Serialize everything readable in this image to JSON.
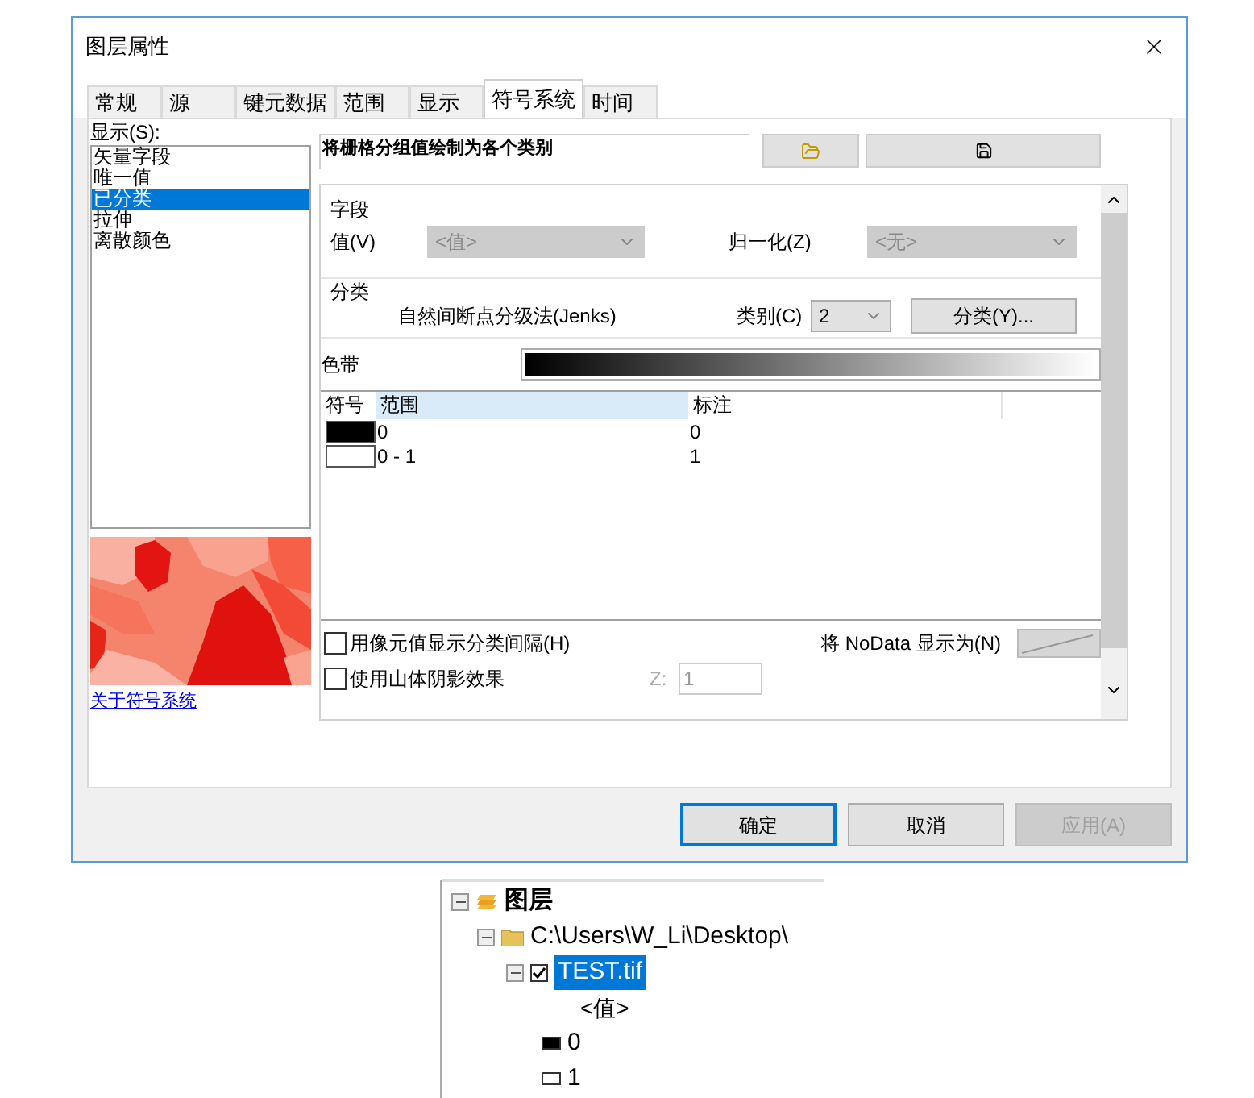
{
  "window": {
    "title": "图层属性"
  },
  "tabs": [
    {
      "label": "常规",
      "selected": false
    },
    {
      "label": "源",
      "selected": false
    },
    {
      "label": "键元数据",
      "selected": false
    },
    {
      "label": "范围",
      "selected": false
    },
    {
      "label": "显示",
      "selected": false
    },
    {
      "label": "符号系统",
      "selected": true
    },
    {
      "label": "时间",
      "selected": false
    }
  ],
  "show_list": {
    "label": "显示(S):",
    "items": [
      {
        "label": "矢量字段",
        "selected": false
      },
      {
        "label": "唯一值",
        "selected": false
      },
      {
        "label": "已分类",
        "selected": true
      },
      {
        "label": "拉伸",
        "selected": false
      },
      {
        "label": "离散颜色",
        "selected": false
      }
    ]
  },
  "about_link": "关于符号系统",
  "description": "将栅格分组值绘制为各个类别",
  "fields": {
    "title": "字段",
    "value_label": "值(V)",
    "value": "<值>",
    "normalize_label": "归一化(Z)",
    "normalize": "<无>"
  },
  "classification": {
    "title": "分类",
    "method": "自然间断点分级法(Jenks)",
    "classes_label": "类别(C)",
    "classes": "2",
    "button": "分类(Y)..."
  },
  "color_ramp": {
    "label": "色带"
  },
  "table": {
    "columns": [
      "符号",
      "范围",
      "标注"
    ],
    "rows": [
      {
        "color": "#000000",
        "range": "0",
        "label": "0"
      },
      {
        "color": "#ffffff",
        "range": "0 - 1",
        "label": "1"
      }
    ]
  },
  "options": [
    {
      "label": "用像元值显示分类间隔(H)",
      "checked": false
    },
    {
      "label": "使用山体阴影效果",
      "checked": false
    }
  ],
  "z": {
    "label": "Z:",
    "value": "1"
  },
  "nodata_label": "将 NoData 显示为(N)",
  "buttons": [
    {
      "label": "确定",
      "default": true,
      "disabled": false
    },
    {
      "label": "取消",
      "default": false,
      "disabled": false
    },
    {
      "label": "应用(A)",
      "default": false,
      "disabled": true
    }
  ],
  "toc": [
    {
      "label": "图层",
      "kind": "layers",
      "expanded": true,
      "children": [
        {
          "label": "C:\\Users\\W_Li\\Desktop\\",
          "kind": "folder",
          "expanded": true,
          "children": [
            {
              "label": "TEST.tif",
              "kind": "layer",
              "checked": true,
              "selected": true,
              "expanded": true,
              "children": [
                {
                  "label": "<值>",
                  "kind": "heading"
                },
                {
                  "label": "0",
                  "kind": "class",
                  "color": "#000000"
                },
                {
                  "label": "1",
                  "kind": "class",
                  "color": "#ffffff"
                }
              ]
            }
          ]
        }
      ]
    }
  ]
}
